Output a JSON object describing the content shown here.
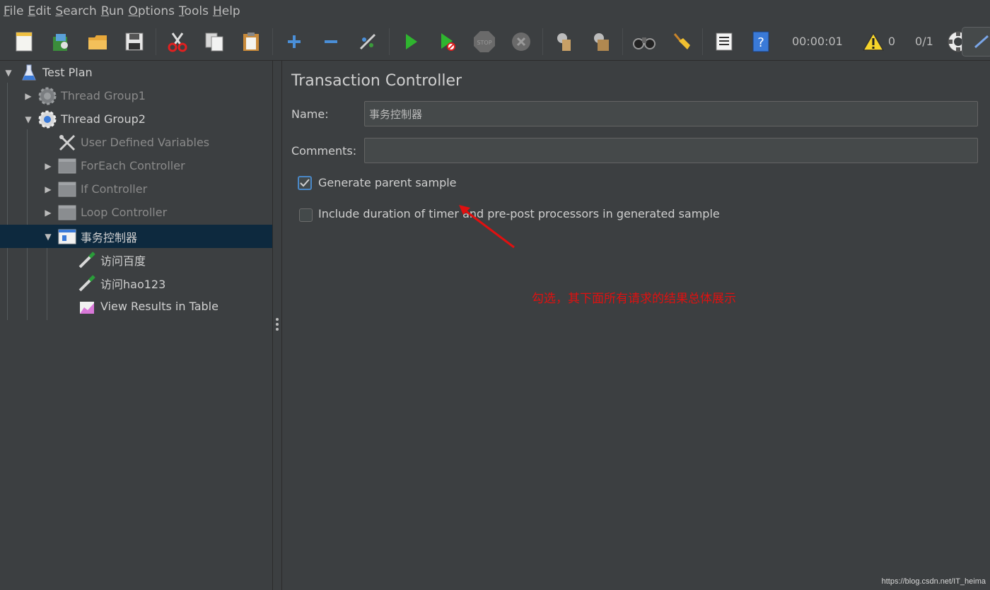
{
  "menu": [
    {
      "mnemonic": "F",
      "rest": "ile"
    },
    {
      "mnemonic": "E",
      "rest": "dit"
    },
    {
      "mnemonic": "S",
      "rest": "earch"
    },
    {
      "mnemonic": "R",
      "rest": "un"
    },
    {
      "mnemonic": "O",
      "rest": "ptions"
    },
    {
      "mnemonic": "T",
      "rest": "ools"
    },
    {
      "mnemonic": "H",
      "rest": "elp"
    }
  ],
  "toolbar": {
    "timer": "00:00:01",
    "warning_count": "0",
    "threads": "0/1"
  },
  "tree": {
    "items": [
      {
        "label": "Test Plan",
        "icon": "test-plan-flask-icon"
      },
      {
        "label": "Thread Group1",
        "icon": "gear-icon"
      },
      {
        "label": "Thread Group2",
        "icon": "gear-icon"
      },
      {
        "label": "User Defined Variables",
        "icon": "tools-icon"
      },
      {
        "label": "ForEach Controller",
        "icon": "controller-icon"
      },
      {
        "label": "If Controller",
        "icon": "controller-icon"
      },
      {
        "label": "Loop Controller",
        "icon": "controller-icon"
      },
      {
        "label": "事务控制器",
        "icon": "controller-icon"
      },
      {
        "label": "访问百度",
        "icon": "pipette-icon"
      },
      {
        "label": "访问hao123",
        "icon": "pipette-icon"
      },
      {
        "label": "View Results in Table",
        "icon": "chart-icon"
      }
    ]
  },
  "panel": {
    "title": "Transaction Controller",
    "name_label": "Name:",
    "name_value": "事务控制器",
    "comments_label": "Comments:",
    "comments_value": "",
    "generate_parent_label": "Generate parent sample",
    "generate_parent_checked": true,
    "include_duration_label": "Include duration of timer and pre-post processors in generated sample",
    "include_duration_checked": false
  },
  "annotation": {
    "text": "勾选，其下面所有请求的结果总体展示",
    "color": "#e01010"
  },
  "watermark": "https://blog.csdn.net/IT_heima"
}
